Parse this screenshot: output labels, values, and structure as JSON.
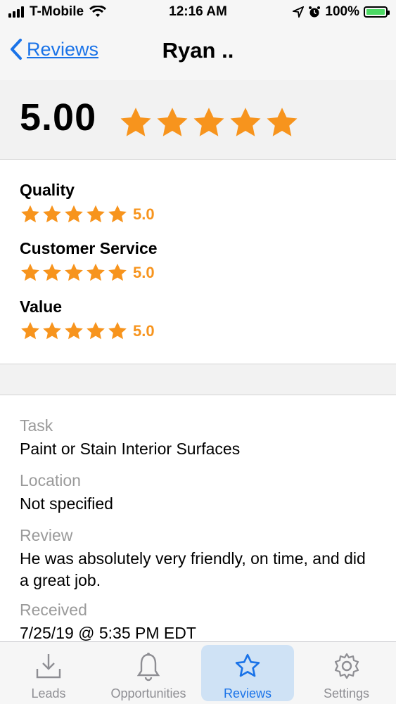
{
  "status_bar": {
    "carrier": "T-Mobile",
    "time": "12:16 AM",
    "battery": "100%"
  },
  "nav": {
    "back_label": "Reviews",
    "title": "Ryan .."
  },
  "overall": {
    "score": "5.00",
    "stars": 5
  },
  "categories": [
    {
      "label": "Quality",
      "score": "5.0",
      "stars": 5
    },
    {
      "label": "Customer Service",
      "score": "5.0",
      "stars": 5
    },
    {
      "label": "Value",
      "score": "5.0",
      "stars": 5
    }
  ],
  "details": {
    "task_label": "Task",
    "task_value": "Paint or Stain Interior Surfaces",
    "location_label": "Location",
    "location_value": "Not specified",
    "review_label": "Review",
    "review_value": "He was absolutely very friendly, on time, and did a great job.",
    "received_label": "Received",
    "received_value": "7/25/19 @ 5:35 PM EDT"
  },
  "tabs": [
    {
      "label": "Leads",
      "icon": "download-tray-icon"
    },
    {
      "label": "Opportunities",
      "icon": "bell-icon"
    },
    {
      "label": "Reviews",
      "icon": "star-outline-icon",
      "active": true
    },
    {
      "label": "Settings",
      "icon": "gear-icon"
    }
  ],
  "colors": {
    "accent": "#1a73e8",
    "star": "#f7941d",
    "active_tab_bg": "#cfe2f5"
  }
}
